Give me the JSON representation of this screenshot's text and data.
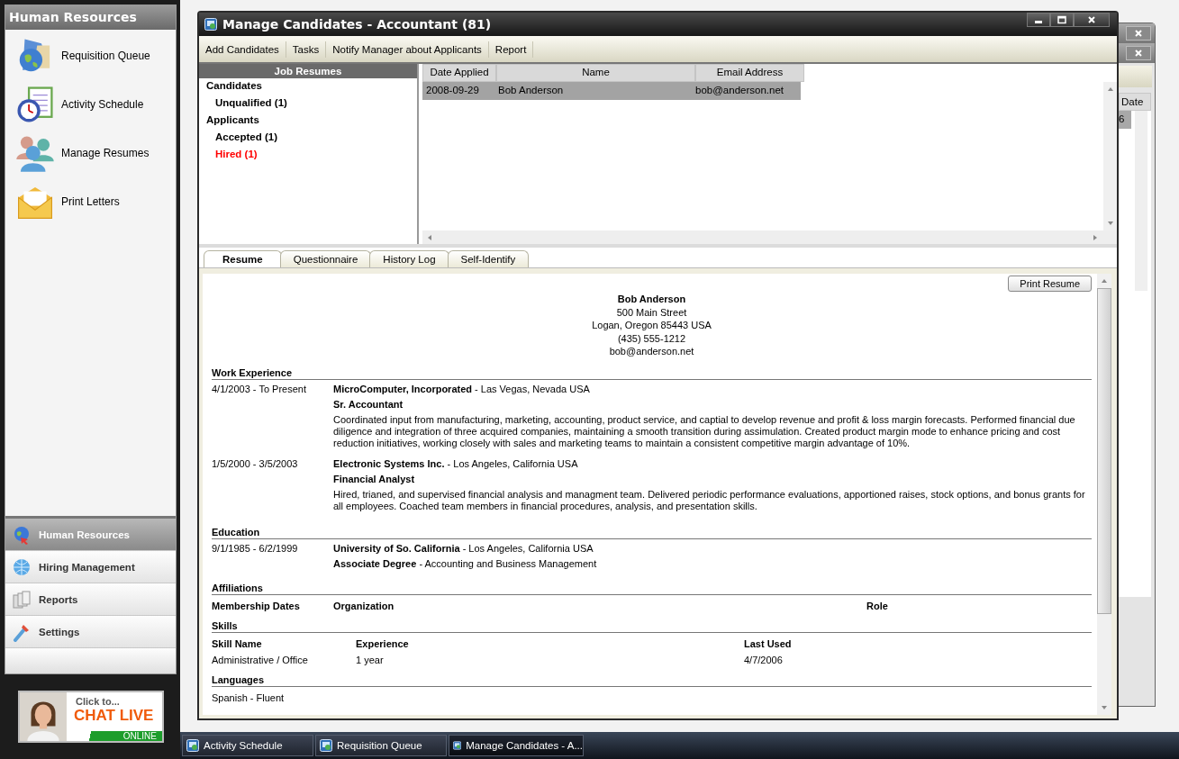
{
  "sidebar": {
    "title": "Human Resources",
    "items": [
      {
        "label": "Requisition Queue"
      },
      {
        "label": "Activity Schedule"
      },
      {
        "label": "Manage Resumes"
      },
      {
        "label": "Print Letters"
      }
    ],
    "nav": [
      {
        "label": "Human Resources",
        "selected": true
      },
      {
        "label": "Hiring Management",
        "selected": false
      },
      {
        "label": "Reports",
        "selected": false
      },
      {
        "label": "Settings",
        "selected": false
      }
    ]
  },
  "chat_banner": {
    "kind": "picture",
    "prompt": "Click to...",
    "title": "CHAT LIVE",
    "status": "ONLINE"
  },
  "background_window": {
    "column": "Date",
    "cell": "6"
  },
  "window": {
    "title": "Manage Candidates - Accountant (81)",
    "toolbar": [
      "Add Candidates",
      "Tasks",
      "Notify Manager about Applicants",
      "Report"
    ],
    "tree": {
      "header": "Job Resumes",
      "groups": [
        {
          "label": "Candidates",
          "children": [
            {
              "label": "Unqualified (1)",
              "color": "#000000"
            }
          ]
        },
        {
          "label": "Applicants",
          "children": [
            {
              "label": "Accepted (1)",
              "color": "#000000"
            },
            {
              "label": "Hired (1)",
              "color": "#ff0000"
            }
          ]
        }
      ]
    },
    "grid": {
      "columns": [
        "Date Applied",
        "Name",
        "Email Address"
      ],
      "rows": [
        {
          "cells": [
            "2008-09-29",
            "Bob Anderson",
            "bob@anderson.net"
          ],
          "selected": true
        }
      ]
    },
    "tabs": [
      {
        "label": "Resume",
        "selected": true
      },
      {
        "label": "Questionnaire",
        "selected": false
      },
      {
        "label": "History Log",
        "selected": false
      },
      {
        "label": "Self-Identify",
        "selected": false
      }
    ],
    "resume": {
      "print_button": "Print Resume",
      "name": "Bob Anderson",
      "contact": [
        "500 Main Street",
        "Logan, Oregon 85443 USA",
        "(435) 555-1212",
        "bob@anderson.net"
      ],
      "sections": [
        {
          "kind": "entries",
          "title": "Work Experience",
          "entries": [
            {
              "date": "4/1/2003 - To Present",
              "lines": [
                "**MicroComputer, Incorporated** - Las Vegas, Nevada USA",
                "**Sr. Accountant**"
              ],
              "description": "Coordinated input from manufacturing, marketing, accounting, product service, and captial to develop revenue and profit & loss margin forecasts. Performed financial due diligence and integration of three acquired companies, maintaining a smooth transition during assimulation. Created product margin mode to enhance pricing and cost reduction initiatives, working closely with sales and marketing teams to maintain a consistent competitive margin advantage of 10%."
            },
            {
              "date": "1/5/2000 - 3/5/2003",
              "lines": [
                "**Electronic Systems Inc.** - Los Angeles, California USA",
                "**Financial Analyst**"
              ],
              "description": "Hired, trianed, and supervised financial analysis and managment team. Delivered periodic performance evaluations, apportioned raises, stock options, and bonus grants for all employees. Coached team members in financial procedures, analysis, and presentation skills."
            }
          ]
        },
        {
          "kind": "entries",
          "title": "Education",
          "entries": [
            {
              "date": "9/1/1985 - 6/2/1999",
              "lines": [
                "**University of So. California** - Los Angeles, California USA",
                "**Associate Degree** - Accounting and Business Management"
              ]
            }
          ]
        },
        {
          "kind": "table",
          "title": "Affiliations",
          "columns": [
            "Membership Dates",
            "Organization",
            "Role"
          ]
        },
        {
          "kind": "table",
          "title": "Skills",
          "columns": [
            "Skill Name",
            "Experience",
            "Last Used"
          ],
          "rows": [
            [
              "Administrative / Office",
              "1 year",
              "4/7/2006"
            ]
          ]
        },
        {
          "kind": "list",
          "title": "Languages",
          "items": [
            "Spanish - Fluent"
          ]
        }
      ]
    }
  },
  "taskbar": [
    {
      "label": "Activity Schedule",
      "selected": false
    },
    {
      "label": "Requisition Queue",
      "selected": false
    },
    {
      "label": "Manage Candidates - A...",
      "selected": true
    }
  ]
}
